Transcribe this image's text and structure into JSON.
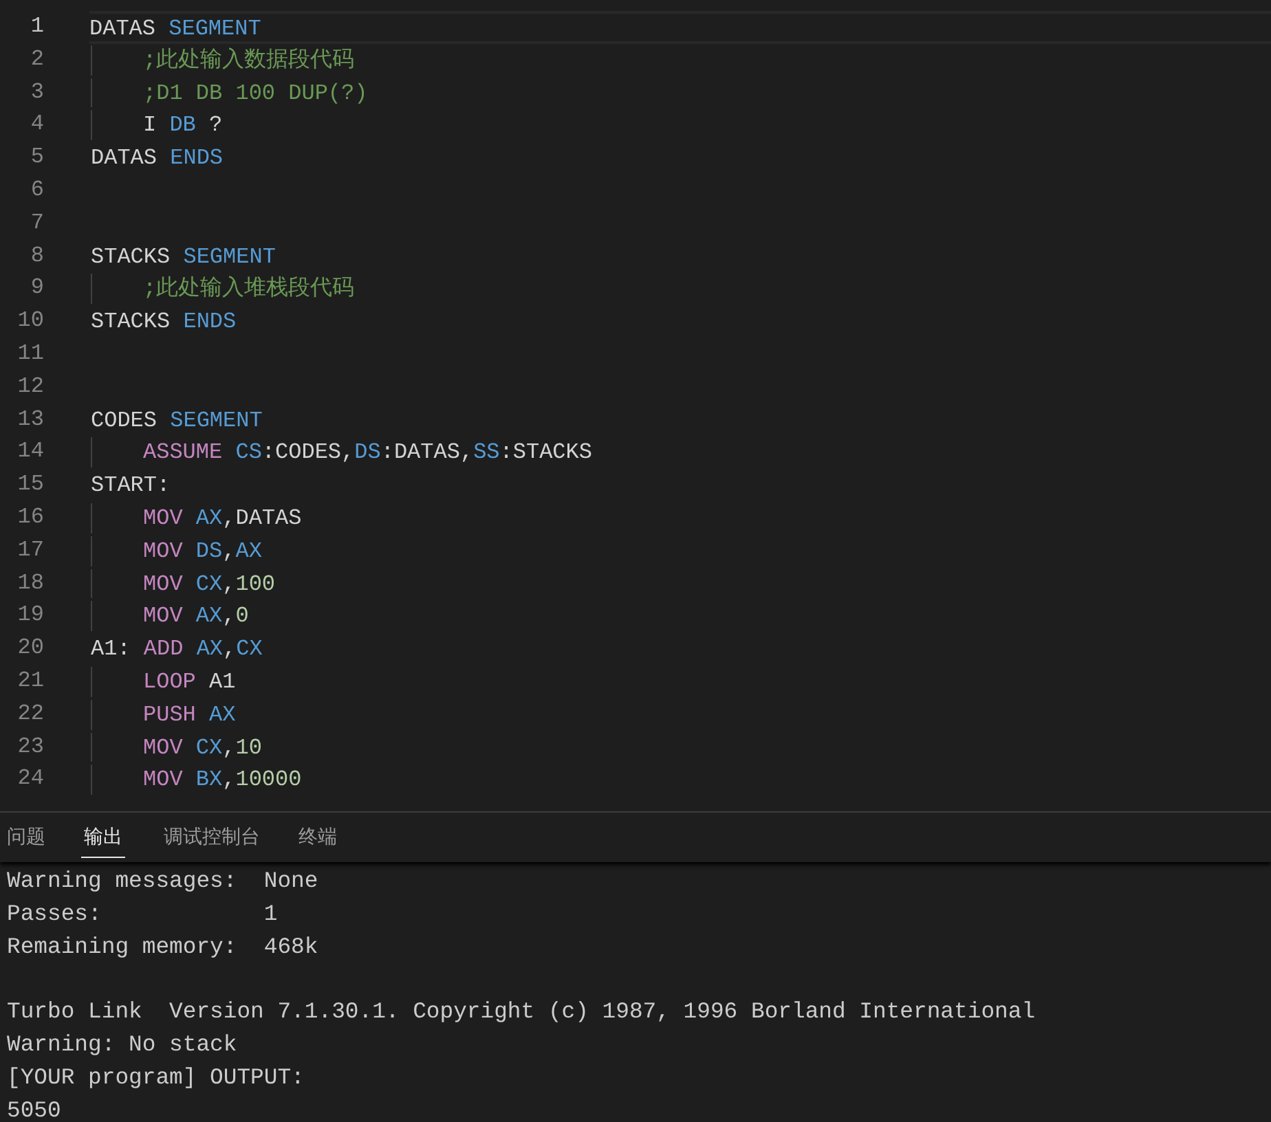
{
  "editor": {
    "lines": [
      {
        "number": "1",
        "current": true,
        "indent": false,
        "tokens": [
          {
            "kind": "plain",
            "text": "DATAS "
          },
          {
            "kind": "keyword",
            "text": "SEGMENT"
          }
        ]
      },
      {
        "number": "2",
        "current": false,
        "indent": true,
        "tokens": [
          {
            "kind": "comment",
            "text": ";此处输入数据段代码"
          }
        ]
      },
      {
        "number": "3",
        "current": false,
        "indent": true,
        "tokens": [
          {
            "kind": "comment",
            "text": ";D1 DB 100 DUP(?)"
          }
        ]
      },
      {
        "number": "4",
        "current": false,
        "indent": true,
        "tokens": [
          {
            "kind": "plain",
            "text": "I "
          },
          {
            "kind": "keyword",
            "text": "DB"
          },
          {
            "kind": "plain",
            "text": " ?"
          }
        ]
      },
      {
        "number": "5",
        "current": false,
        "indent": false,
        "tokens": [
          {
            "kind": "plain",
            "text": "DATAS "
          },
          {
            "kind": "keyword",
            "text": "ENDS"
          }
        ]
      },
      {
        "number": "6",
        "current": false
      },
      {
        "number": "7",
        "current": false
      },
      {
        "number": "8",
        "current": false,
        "indent": false,
        "tokens": [
          {
            "kind": "plain",
            "text": "STACKS "
          },
          {
            "kind": "keyword",
            "text": "SEGMENT"
          }
        ]
      },
      {
        "number": "9",
        "current": false,
        "indent": true,
        "tokens": [
          {
            "kind": "comment",
            "text": ";此处输入堆栈段代码"
          }
        ]
      },
      {
        "number": "10",
        "current": false,
        "indent": false,
        "tokens": [
          {
            "kind": "plain",
            "text": "STACKS "
          },
          {
            "kind": "keyword",
            "text": "ENDS"
          }
        ]
      },
      {
        "number": "11",
        "current": false
      },
      {
        "number": "12",
        "current": false
      },
      {
        "number": "13",
        "current": false,
        "indent": false,
        "tokens": [
          {
            "kind": "plain",
            "text": "CODES "
          },
          {
            "kind": "keyword",
            "text": "SEGMENT"
          }
        ]
      },
      {
        "number": "14",
        "current": false,
        "indent": true,
        "tokens": [
          {
            "kind": "instruction",
            "text": "ASSUME "
          },
          {
            "kind": "keyword",
            "text": "CS"
          },
          {
            "kind": "plain",
            "text": ":CODES,"
          },
          {
            "kind": "keyword",
            "text": "DS"
          },
          {
            "kind": "plain",
            "text": ":DATAS,"
          },
          {
            "kind": "keyword",
            "text": "SS"
          },
          {
            "kind": "plain",
            "text": ":STACKS"
          }
        ]
      },
      {
        "number": "15",
        "current": false,
        "indent": false,
        "tokens": [
          {
            "kind": "plain",
            "text": "START:"
          }
        ]
      },
      {
        "number": "16",
        "current": false,
        "indent": true,
        "tokens": [
          {
            "kind": "instruction",
            "text": "MOV "
          },
          {
            "kind": "keyword",
            "text": "AX"
          },
          {
            "kind": "plain",
            "text": ",DATAS"
          }
        ]
      },
      {
        "number": "17",
        "current": false,
        "indent": true,
        "tokens": [
          {
            "kind": "instruction",
            "text": "MOV "
          },
          {
            "kind": "keyword",
            "text": "DS"
          },
          {
            "kind": "plain",
            "text": ","
          },
          {
            "kind": "keyword",
            "text": "AX"
          }
        ]
      },
      {
        "number": "18",
        "current": false,
        "indent": true,
        "tokens": [
          {
            "kind": "instruction",
            "text": "MOV "
          },
          {
            "kind": "keyword",
            "text": "CX"
          },
          {
            "kind": "plain",
            "text": ","
          },
          {
            "kind": "number",
            "text": "100"
          }
        ]
      },
      {
        "number": "19",
        "current": false,
        "indent": true,
        "tokens": [
          {
            "kind": "instruction",
            "text": "MOV "
          },
          {
            "kind": "keyword",
            "text": "AX"
          },
          {
            "kind": "plain",
            "text": ","
          },
          {
            "kind": "number",
            "text": "0"
          }
        ]
      },
      {
        "number": "20",
        "current": false,
        "indent": false,
        "tokens": [
          {
            "kind": "plain",
            "text": "A1: "
          },
          {
            "kind": "instruction",
            "text": "ADD "
          },
          {
            "kind": "keyword",
            "text": "AX"
          },
          {
            "kind": "plain",
            "text": ","
          },
          {
            "kind": "keyword",
            "text": "CX"
          }
        ]
      },
      {
        "number": "21",
        "current": false,
        "indent": true,
        "tokens": [
          {
            "kind": "instruction",
            "text": "LOOP "
          },
          {
            "kind": "plain",
            "text": "A1"
          }
        ]
      },
      {
        "number": "22",
        "current": false,
        "indent": true,
        "tokens": [
          {
            "kind": "instruction",
            "text": "PUSH "
          },
          {
            "kind": "keyword",
            "text": "AX"
          }
        ]
      },
      {
        "number": "23",
        "current": false,
        "indent": true,
        "tokens": [
          {
            "kind": "instruction",
            "text": "MOV "
          },
          {
            "kind": "keyword",
            "text": "CX"
          },
          {
            "kind": "plain",
            "text": ","
          },
          {
            "kind": "number",
            "text": "10"
          }
        ]
      },
      {
        "number": "24",
        "current": false,
        "indent": true,
        "tokens": [
          {
            "kind": "instruction",
            "text": "MOV "
          },
          {
            "kind": "keyword",
            "text": "BX"
          },
          {
            "kind": "plain",
            "text": ","
          },
          {
            "kind": "number",
            "text": "10000"
          }
        ]
      }
    ]
  },
  "panel": {
    "tabs": [
      {
        "label": "问题",
        "selected": false
      },
      {
        "label": "输出",
        "selected": true
      },
      {
        "label": "调试控制台",
        "selected": false
      },
      {
        "label": "终端",
        "selected": false
      }
    ],
    "output": [
      [
        "Warning messages:  None",
        "Passes:            1",
        "Remaining memory:  468k"
      ],
      [
        "Turbo Link  Version 7.1.30.1. Copyright (c) 1987, 1996 Borland International",
        "Warning: No stack",
        "[YOUR program] OUTPUT:",
        "5050"
      ]
    ]
  }
}
